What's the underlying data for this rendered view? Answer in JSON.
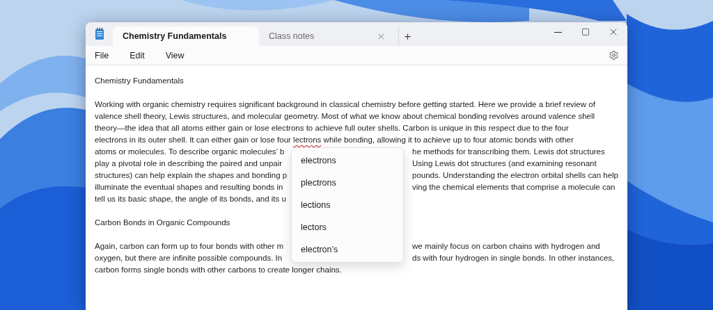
{
  "window": {
    "tabs": [
      {
        "label": "Chemistry Fundamentals",
        "selected": true
      },
      {
        "label": "Class notes",
        "selected": false
      }
    ],
    "new_tab": "+"
  },
  "menu_bar": {
    "items": [
      "File",
      "Edit",
      "View"
    ]
  },
  "document": {
    "blocks": [
      {
        "lines": [
          {
            "kind": "full",
            "text": "Chemistry Fundamentals"
          }
        ]
      },
      {
        "lines": [
          {
            "kind": "full",
            "text": "Working with organic chemistry requires significant background in classical chemistry before getting started. Here we provide a brief review of"
          },
          {
            "kind": "full",
            "text": "valence shell theory, Lewis structures, and molecular geometry. Most of what we know about chemical bonding revolves around valence shell"
          },
          {
            "kind": "full",
            "text": "theory—the idea that all atoms either gain or lose electrons to achieve full outer shells. Carbon is unique in this respect due to the four"
          },
          {
            "kind": "spelling",
            "before": "electrons in its outer shell. It can either gain or lose four ",
            "misspelled": "lectrons",
            "after": " while bonding, allowing it to achieve up to four atomic bonds with other"
          },
          {
            "kind": "split",
            "left": "atoms or molecules. To describe organic molecules’ b",
            "right": "he methods for transcribing them. Lewis dot structures"
          },
          {
            "kind": "split",
            "left": "play a pivotal role in describing the paired and unpair",
            "right": "Using Lewis dot structures (and examining resonant"
          },
          {
            "kind": "split",
            "left": "structures) can help explain the shapes and bonding p",
            "right": "pounds. Understanding the electron orbital shells can help"
          },
          {
            "kind": "split",
            "left": "illuminate the eventual shapes and resulting bonds in",
            "right": "ving the chemical elements that comprise a molecule can"
          },
          {
            "kind": "split",
            "left": "tell us its basic shape, the angle of its bonds, and its u"
          }
        ]
      },
      {
        "lines": [
          {
            "kind": "full",
            "text": "Carbon Bonds in Organic Compounds"
          }
        ]
      },
      {
        "lines": [
          {
            "kind": "split",
            "left": "Again, carbon can form up to four bonds with other m",
            "right": "we mainly focus on carbon chains with hydrogen and"
          },
          {
            "kind": "split",
            "left": "oxygen, but there are infinite possible compounds. In",
            "right": "ds with four hydrogen in single bonds. In other instances,"
          },
          {
            "kind": "full",
            "text": "carbon forms single bonds with other carbons to create longer chains."
          }
        ]
      }
    ]
  },
  "suggestions": [
    "electrons",
    "plectrons",
    "lections",
    "lectors",
    "electron’s"
  ]
}
